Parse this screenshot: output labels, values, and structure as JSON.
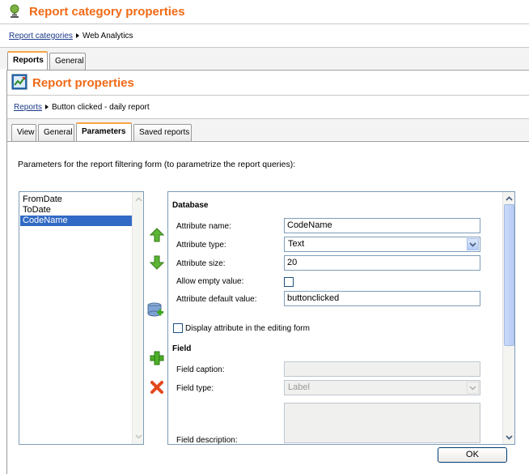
{
  "header": {
    "title": "Report category properties"
  },
  "breadcrumb": {
    "link": "Report categories",
    "current": "Web Analytics"
  },
  "outer_tabs": [
    {
      "label": "Reports",
      "active": true
    },
    {
      "label": "General",
      "active": false
    }
  ],
  "report_header": {
    "title": "Report properties"
  },
  "report_breadcrumb": {
    "link": "Reports",
    "current": "Button clicked - daily report"
  },
  "inner_tabs": [
    {
      "label": "View",
      "active": false
    },
    {
      "label": "General",
      "active": false
    },
    {
      "label": "Parameters",
      "active": true
    },
    {
      "label": "Saved reports",
      "active": false
    }
  ],
  "description": "Parameters for the report filtering form (to parametrize the report queries):",
  "attributes_list": {
    "items": [
      "FromDate",
      "ToDate",
      "CodeName"
    ],
    "selected": "CodeName"
  },
  "side_icons": [
    "move-up-icon",
    "move-down-icon",
    "add-system-attribute-icon",
    "add-attribute-icon",
    "delete-attribute-icon"
  ],
  "database_section": {
    "title": "Database",
    "attribute_name_label": "Attribute name:",
    "attribute_name_value": "CodeName",
    "attribute_type_label": "Attribute type:",
    "attribute_type_value": "Text",
    "attribute_size_label": "Attribute size:",
    "attribute_size_value": "20",
    "allow_empty_label": "Allow empty value:",
    "allow_empty_checked": false,
    "default_value_label": "Attribute default value:",
    "default_value_value": "buttonclicked",
    "display_in_form_label": "Display attribute in the editing form",
    "display_in_form_checked": false
  },
  "field_section": {
    "title": "Field",
    "caption_label": "Field caption:",
    "caption_value": "",
    "type_label": "Field type:",
    "type_value": "Label",
    "description_label": "Field description:"
  },
  "ok_button": {
    "label": "OK"
  },
  "colors": {
    "title_orange": "#f06a16",
    "selection_blue": "#316ac5",
    "link_blue": "#1a3a8a",
    "tab_accent": "#f7a546"
  }
}
